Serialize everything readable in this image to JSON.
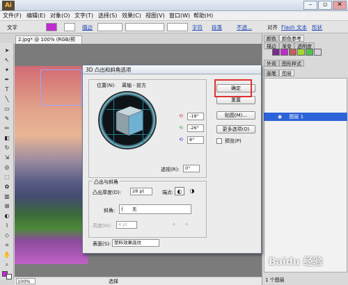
{
  "app": {
    "logo_text": "Ai"
  },
  "window_controls": {
    "minimize": "–",
    "restore": "▫",
    "close": "✕"
  },
  "menu": [
    "文件(F)",
    "编辑(E)",
    "对象(O)",
    "文字(T)",
    "选择(S)",
    "效果(C)",
    "视图(V)",
    "窗口(W)",
    "帮助(H)"
  ],
  "control_bar": {
    "type_label": "文字",
    "stroke_label": "描边",
    "char_label": "字符",
    "para_label": "段落",
    "opacity_label": "不透...",
    "align_label": "对齐",
    "flash_label": "Flash 文本",
    "shape_label": "形状"
  },
  "document": {
    "tab_title": "2.jpg* @ 100% (RGB/预览)",
    "zoom": "100%",
    "status_label": "选择"
  },
  "right_panel": {
    "top_tabs": [
      "颜色",
      "颜色参考"
    ],
    "mid_tabs": [
      "描边",
      "渐变",
      "透明度"
    ],
    "appearance_tabs": [
      "外观",
      "图形样式"
    ],
    "layer_tabs": [
      "画笔",
      "图层"
    ],
    "layer_name": "图层 1",
    "layer_count": "1 个图层",
    "swatch_colors": [
      "#7a2d8c",
      "#c02bd0",
      "#c06060",
      "#a6d632",
      "#52c24a",
      "#d9d0e0"
    ]
  },
  "dialog": {
    "title": "3D 凸出和斜角选项",
    "position_label": "位置(N):",
    "position_value": "离轴 - 前方",
    "rotation_x": "-18°",
    "rotation_y": "-26°",
    "rotation_z": "8°",
    "perspective_label": "透视(R):",
    "perspective_value": "0°",
    "extrude_section": "凸出与斜角",
    "extrude_depth_label": "凸出厚度(D):",
    "extrude_depth_value": "28 pt",
    "cap_label": "端点:",
    "bevel_label": "斜角:",
    "bevel_value": "无",
    "height_label": "高度(H):",
    "height_value": "4 pt",
    "surface_label": "表面(S):",
    "surface_value": "塑料效果底纹",
    "buttons": {
      "ok": "确定",
      "reset": "重置",
      "map": "贴图(M)...",
      "more": "更多选项(O)",
      "preview": "预览(P)"
    }
  },
  "watermark": "Baidu 经验"
}
